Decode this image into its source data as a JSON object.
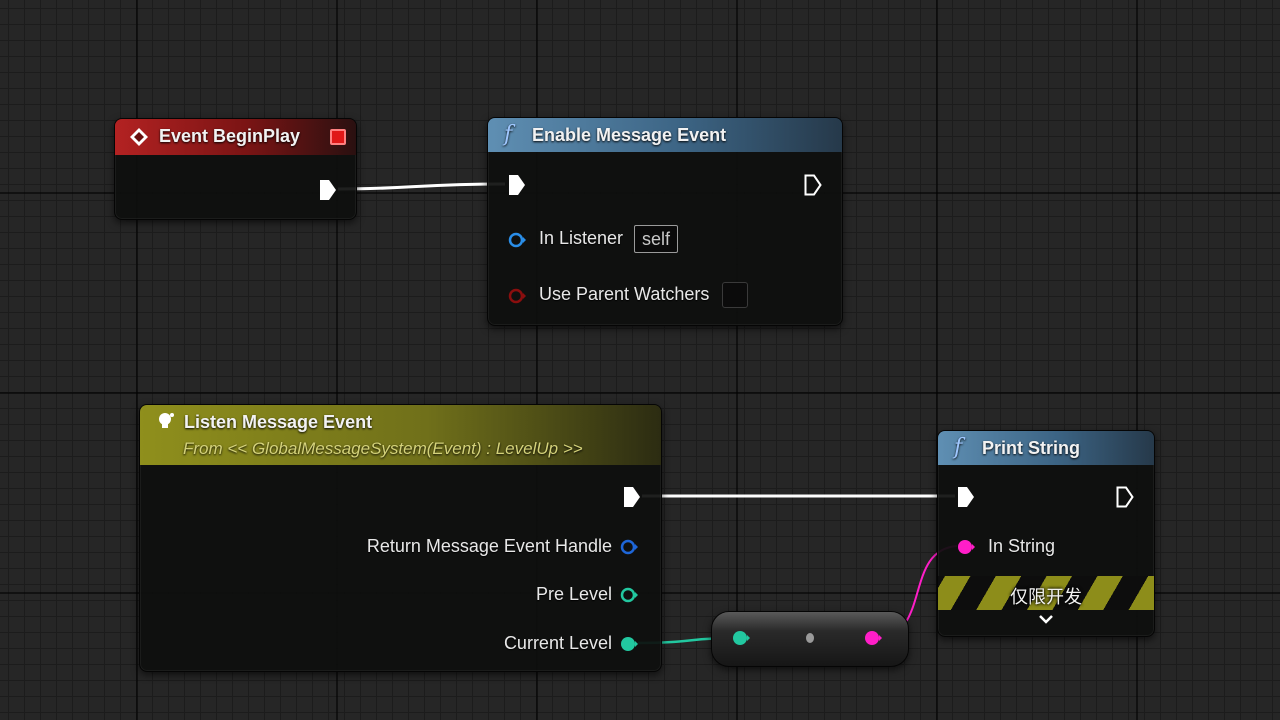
{
  "nodes": {
    "begin_play": {
      "title": "Event BeginPlay",
      "icon": "event-diamond-icon",
      "header_color": "#b32222"
    },
    "enable_message": {
      "title": "Enable Message Event",
      "icon": "function-icon",
      "header_color": "#5f8fb3",
      "pins": {
        "in_listener": {
          "label": "In Listener",
          "value": "self",
          "color": "#2a8ee8"
        },
        "use_parent_watchers": {
          "label": "Use Parent Watchers",
          "checked": false,
          "color": "#8a0e0e"
        }
      }
    },
    "listen_message": {
      "title": "Listen Message Event",
      "subtitle": "From << GlobalMessageSystem(Event) : LevelUp >>",
      "icon": "lightbulb-icon",
      "header_color": "#8f8f1c",
      "pins": {
        "return_handle": {
          "label": "Return Message Event Handle",
          "color": "#1e66d8"
        },
        "pre_level": {
          "label": "Pre Level",
          "color": "#22c8a0"
        },
        "current_level": {
          "label": "Current Level",
          "color": "#22c8a0"
        }
      }
    },
    "print_string": {
      "title": "Print String",
      "icon": "function-icon",
      "header_color": "#5f8fb3",
      "pins": {
        "in_string": {
          "label": "In String",
          "color": "#ff1ec8"
        }
      },
      "dev_only_label": "仅限开发"
    }
  },
  "icons": {
    "exec": "exec-arrow-icon",
    "stop": "stop-icon",
    "expand": "chevron-down-icon"
  },
  "colors": {
    "exec_wire": "#ffffff",
    "int_wire": "#22c8a0",
    "string_wire": "#ff1ec8"
  }
}
